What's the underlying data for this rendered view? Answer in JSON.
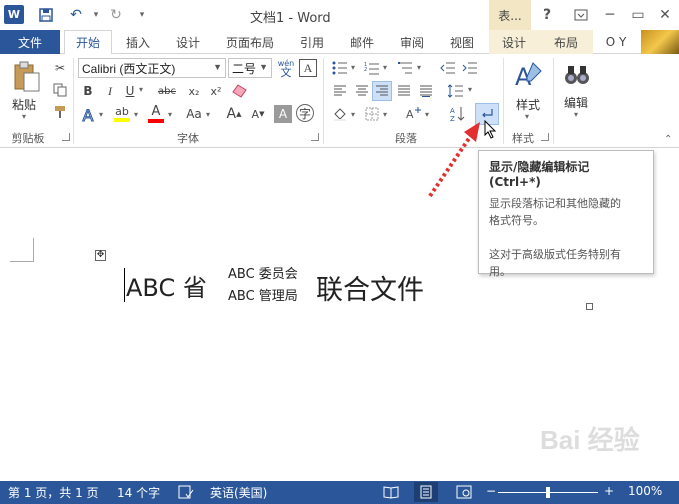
{
  "window": {
    "title": "文档1 - Word",
    "context_tab_header": "表...",
    "help": "?",
    "minimize": "─",
    "restore": "▭",
    "close": "✕"
  },
  "tabs": [
    {
      "label": "文件"
    },
    {
      "label": "开始"
    },
    {
      "label": "插入"
    },
    {
      "label": "设计"
    },
    {
      "label": "页面布局"
    },
    {
      "label": "引用"
    },
    {
      "label": "邮件"
    },
    {
      "label": "审阅"
    },
    {
      "label": "视图"
    },
    {
      "label": "设计"
    },
    {
      "label": "布局"
    }
  ],
  "user": "O Y",
  "ribbon": {
    "clipboard": {
      "paste_label": "粘贴",
      "group_label": "剪贴板"
    },
    "font": {
      "font_name": "Calibri (西文正文)",
      "font_size": "二号",
      "phonetic_label": "wén",
      "group_label": "字体"
    },
    "paragraph": {
      "group_label": "段落"
    },
    "styles": {
      "label": "样式",
      "group_label": "样式"
    },
    "editing": {
      "label": "编辑"
    }
  },
  "document": {
    "word1": "ABC 省",
    "stacked_line1": "ABC 委员会",
    "stacked_line2": "ABC 管理局",
    "word2": "联合文件"
  },
  "tooltip": {
    "title": "显示/隐藏编辑标记 (Ctrl+*)",
    "line1": "显示段落标记和其他隐藏的",
    "line2": "格式符号。",
    "line3": "这对于高级版式任务特别有",
    "line4": "用。"
  },
  "status": {
    "page": "第 1 页，共 1 页",
    "words": "14 个字",
    "language": "英语(美国)",
    "zoom": "100%",
    "zoom_minus": "−",
    "zoom_plus": "+"
  },
  "watermark": "Bai 经验",
  "colors": {
    "brand": "#2b579a",
    "highlight": "#ffff00",
    "font_color": "#ff0000",
    "arrow": "#e03030"
  }
}
